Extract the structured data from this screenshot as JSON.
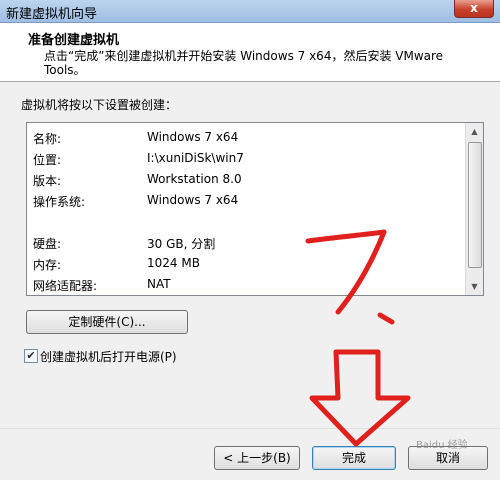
{
  "window": {
    "title": "新建虚拟机向导",
    "close_label": "x"
  },
  "header": {
    "heading": "准备创建虚拟机",
    "description": "点击“完成”来创建虚拟机并开始安装 Windows 7 x64，然后安装 VMware Tools。"
  },
  "summary": {
    "label": "虚拟机将按以下设置被创建：",
    "rows": [
      {
        "key": "名称:",
        "value": "Windows 7 x64"
      },
      {
        "key": "位置:",
        "value": "I:\\xuniDiSk\\win7"
      },
      {
        "key": "版本:",
        "value": "Workstation 8.0"
      },
      {
        "key": "操作系统:",
        "value": "Windows 7 x64"
      },
      {
        "key": "",
        "value": ""
      },
      {
        "key": "硬盘:",
        "value": "30 GB, 分割"
      },
      {
        "key": "内存:",
        "value": "1024 MB"
      },
      {
        "key": "网络适配器:",
        "value": "NAT"
      }
    ]
  },
  "buttons": {
    "customize": "定制硬件(C)...",
    "back": "< 上一步(B)",
    "finish": "完成",
    "cancel": "取消"
  },
  "poweron": {
    "label": "创建虚拟机后打开电源(P)",
    "checked": true
  },
  "annotation": {
    "color": "#e0201c"
  },
  "watermark": "Baidu 经验"
}
